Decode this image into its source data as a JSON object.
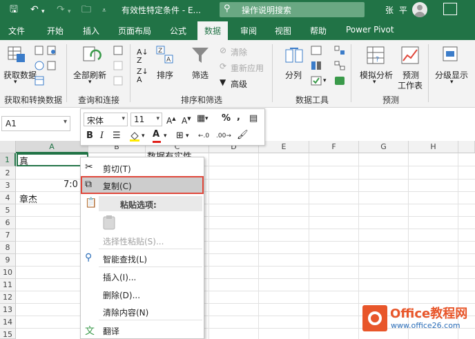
{
  "titlebar": {
    "title": "有效性特定条件 - E...",
    "search_placeholder": "操作说明搜索",
    "user": "张 平"
  },
  "tabs": [
    "文件",
    "开始",
    "插入",
    "页面布局",
    "公式",
    "数据",
    "审阅",
    "视图",
    "帮助",
    "Power Pivot"
  ],
  "active_tab": "数据",
  "ribbon": {
    "get_data": "获取数据",
    "group_get": "获取和转换数据",
    "refresh_all": "全部刷新",
    "group_query": "查询和连接",
    "sort": "排序",
    "filter": "筛选",
    "clear": "清除",
    "reapply": "重新应用",
    "advanced": "高级",
    "group_sort": "排序和筛选",
    "split": "分列",
    "group_tools": "数据工具",
    "whatif": "模拟分析",
    "forecast_line1": "预测",
    "forecast_line2": "工作表",
    "group_forecast": "预测",
    "outline": "分级显示"
  },
  "namebox": "A1",
  "mini_toolbar": {
    "font": "宋体",
    "size": "11"
  },
  "columns": [
    "A",
    "B",
    "C",
    "D",
    "E",
    "F",
    "G",
    "H"
  ],
  "rows": [
    "1",
    "2",
    "3",
    "4",
    "5",
    "6",
    "7",
    "8",
    "9",
    "10",
    "11",
    "12",
    "13",
    "14",
    "15"
  ],
  "cells": {
    "A1": "真",
    "A3": "7:0",
    "A4": "章杰",
    "C1": "数据有实性"
  },
  "context_menu": {
    "cut": "剪切(T)",
    "copy": "复制(C)",
    "paste_options": "粘贴选项:",
    "paste_special": "选择性粘贴(S)...",
    "smart_lookup": "智能查找(L)",
    "insert": "插入(I)...",
    "delete": "删除(D)...",
    "clear_contents": "清除内容(N)",
    "translate": "翻译"
  },
  "watermark": {
    "brand": "Office教程网",
    "url": "www.office26.com"
  },
  "colors": {
    "excel_green": "#217346",
    "highlight_border": "#e0473a",
    "watermark_orange": "#e8562a"
  }
}
